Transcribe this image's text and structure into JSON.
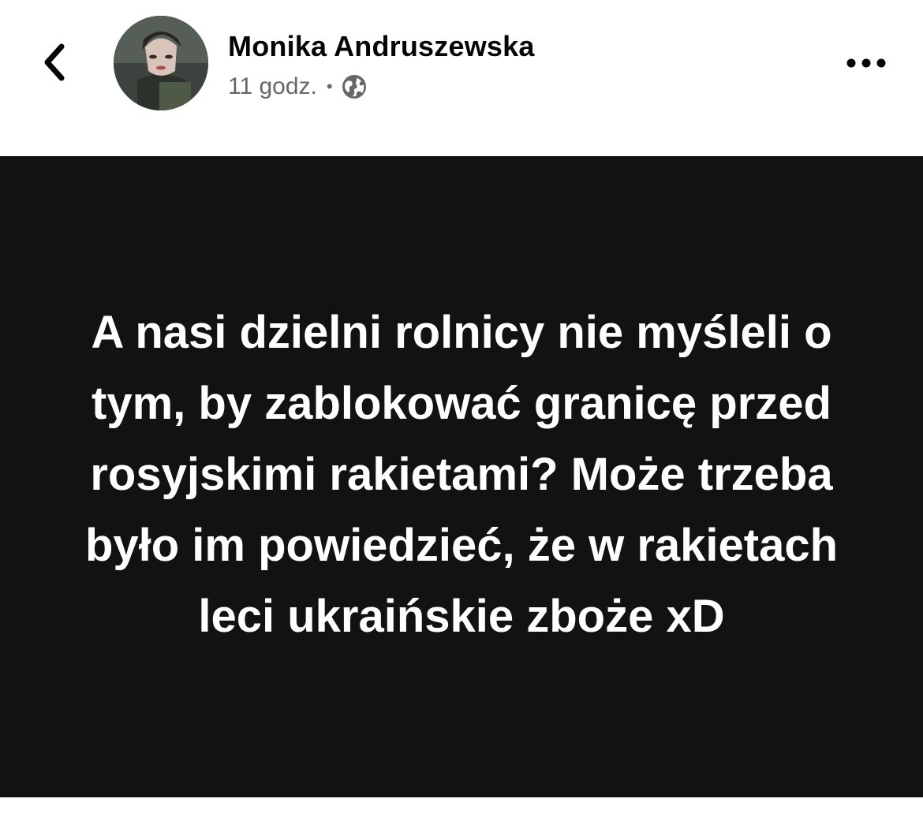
{
  "post": {
    "author_name": "Monika Andruszewska",
    "time": "11 godz.",
    "separator": "•",
    "audience_icon": "globe-icon",
    "text": "A nasi dzielni rolnicy nie myśleli o tym, by zablokować granicę przed rosyjskimi rakietami? Może trzeba było im powiedzieć, że w rakietach leci ukraińskie zboże xD",
    "background_color": "#121212",
    "text_color": "#ffffff"
  },
  "header": {
    "back_icon": "chevron-left-icon",
    "more_icon": "more-horizontal-icon"
  }
}
